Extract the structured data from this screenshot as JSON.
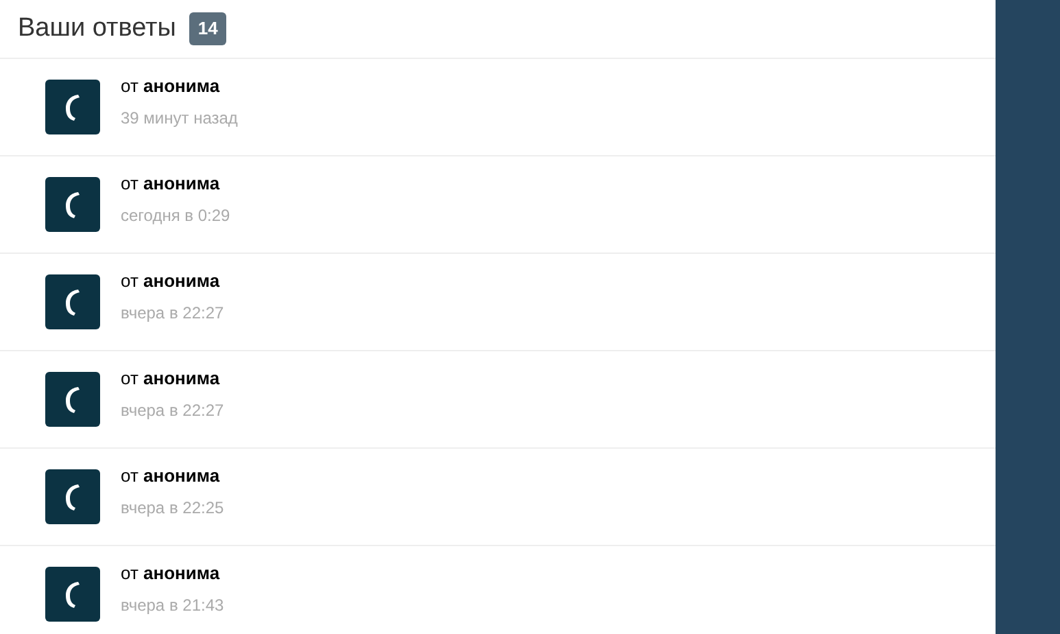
{
  "header": {
    "title": "Ваши ответы",
    "count": "14"
  },
  "answers": [
    {
      "author": "от **анонима**",
      "time": "39 минут назад"
    },
    {
      "author": "от **анонима**",
      "time": "сегодня в 0:29"
    },
    {
      "author": "от **анонима**",
      "time": "вчера в 22:27"
    },
    {
      "author": "от **анонима**",
      "time": "вчера в 22:27"
    },
    {
      "author": "от **анонима**",
      "time": "вчера в 22:25"
    },
    {
      "author": "от **анонима**",
      "time": "вчера в 21:43"
    }
  ]
}
